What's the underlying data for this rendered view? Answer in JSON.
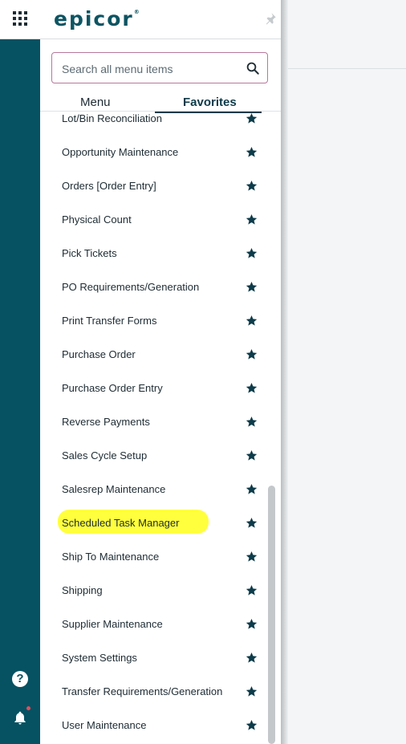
{
  "header": {
    "logo_text": "epicor",
    "logo_tm": "®"
  },
  "search": {
    "placeholder": "Search all menu items",
    "value": ""
  },
  "tabs": [
    {
      "label": "Menu",
      "active": false
    },
    {
      "label": "Favorites",
      "active": true
    }
  ],
  "favorites": {
    "items": [
      {
        "label": "Lot/Bin Reconciliation",
        "favorited": true
      },
      {
        "label": "Opportunity Maintenance",
        "favorited": true
      },
      {
        "label": "Orders [Order Entry]",
        "favorited": true
      },
      {
        "label": "Physical Count",
        "favorited": true
      },
      {
        "label": "Pick Tickets",
        "favorited": true
      },
      {
        "label": "PO Requirements/Generation",
        "favorited": true
      },
      {
        "label": "Print Transfer Forms",
        "favorited": true
      },
      {
        "label": "Purchase Order",
        "favorited": true
      },
      {
        "label": "Purchase Order Entry",
        "favorited": true
      },
      {
        "label": "Reverse Payments",
        "favorited": true
      },
      {
        "label": "Sales Cycle Setup",
        "favorited": true
      },
      {
        "label": "Salesrep Maintenance",
        "favorited": true
      },
      {
        "label": "Scheduled Task Manager",
        "favorited": true,
        "highlighted": true
      },
      {
        "label": "Ship To Maintenance",
        "favorited": true
      },
      {
        "label": "Shipping",
        "favorited": true
      },
      {
        "label": "Supplier Maintenance",
        "favorited": true
      },
      {
        "label": "System Settings",
        "favorited": true
      },
      {
        "label": "Transfer Requirements/Generation",
        "favorited": true
      },
      {
        "label": "User Maintenance",
        "favorited": true
      }
    ]
  },
  "rail": {
    "help_glyph": "?",
    "notification_unread": true
  },
  "colors": {
    "brand_teal": "#065262",
    "star": "#0d3b4a",
    "highlight": "#ffff3d",
    "notification_dot": "#e74c5a"
  }
}
